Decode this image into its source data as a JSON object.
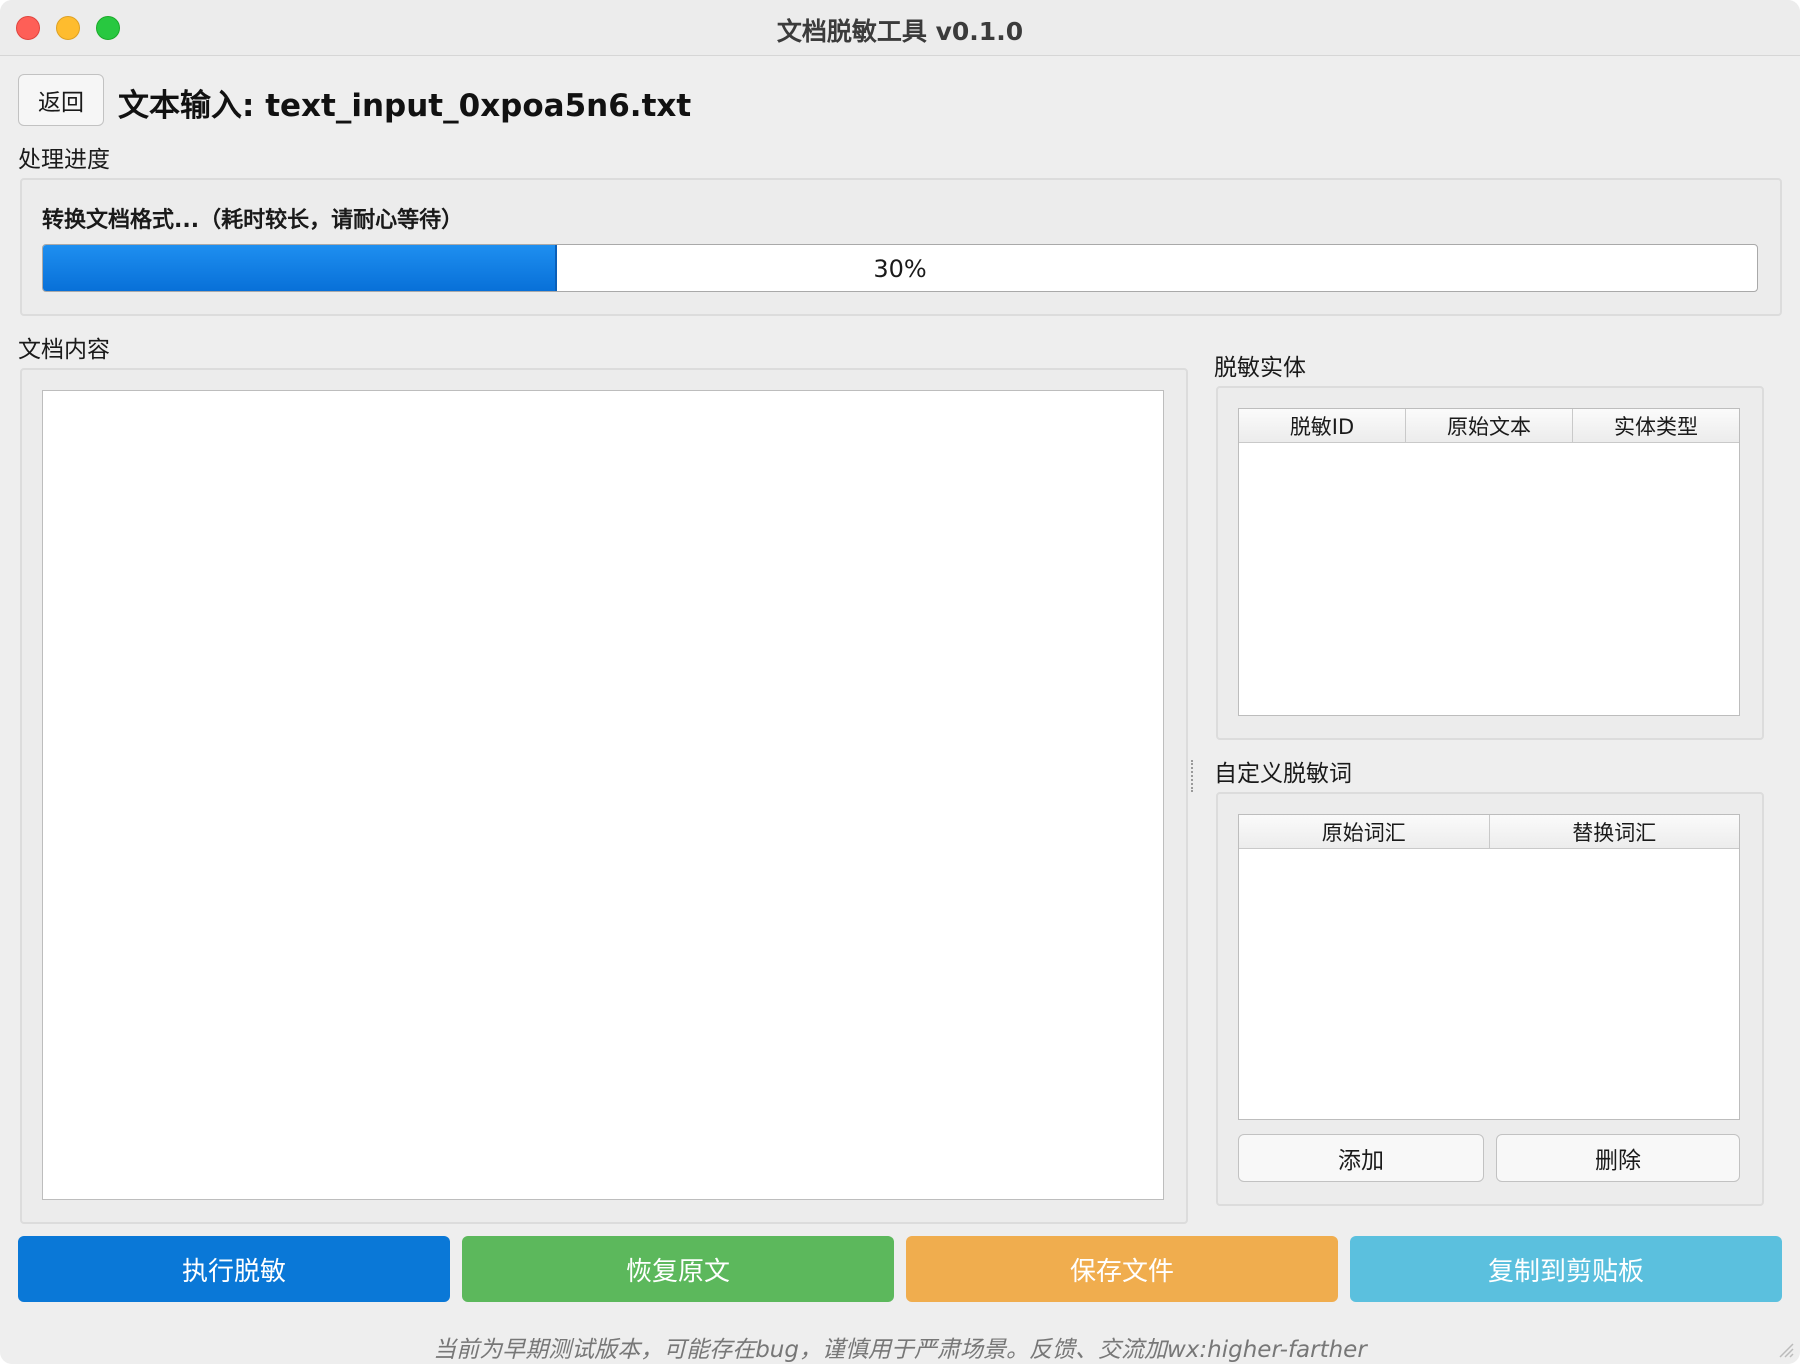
{
  "window": {
    "title": "文档脱敏工具 v0.1.0"
  },
  "header": {
    "back_label": "返回",
    "file_title": "文本输入: text_input_0xpoa5n6.txt"
  },
  "progress": {
    "section_label": "处理进度",
    "status_text": "转换文档格式...（耗时较长，请耐心等待）",
    "percent": 30,
    "percent_label": "30%"
  },
  "document": {
    "section_label": "文档内容",
    "content": ""
  },
  "entities": {
    "section_label": "脱敏实体",
    "columns": [
      "脱敏ID",
      "原始文本",
      "实体类型"
    ],
    "rows": []
  },
  "custom_words": {
    "section_label": "自定义脱敏词",
    "columns": [
      "原始词汇",
      "替换词汇"
    ],
    "rows": [],
    "add_label": "添加",
    "delete_label": "删除"
  },
  "actions": {
    "desensitize": {
      "label": "执行脱敏",
      "color": "#0a78d7"
    },
    "restore": {
      "label": "恢复原文",
      "color": "#5cb85c"
    },
    "save": {
      "label": "保存文件",
      "color": "#f0ad4e"
    },
    "copy": {
      "label": "复制到剪贴板",
      "color": "#5bc0de"
    }
  },
  "footer": {
    "text": "当前为早期测试版本，可能存在bug，谨慎用于严肃场景。反馈、交流加wx:higher-farther"
  },
  "icons": {
    "close": "close-icon",
    "minimize": "minimize-icon",
    "zoom": "zoom-icon",
    "resize": "resize-grip-icon"
  }
}
